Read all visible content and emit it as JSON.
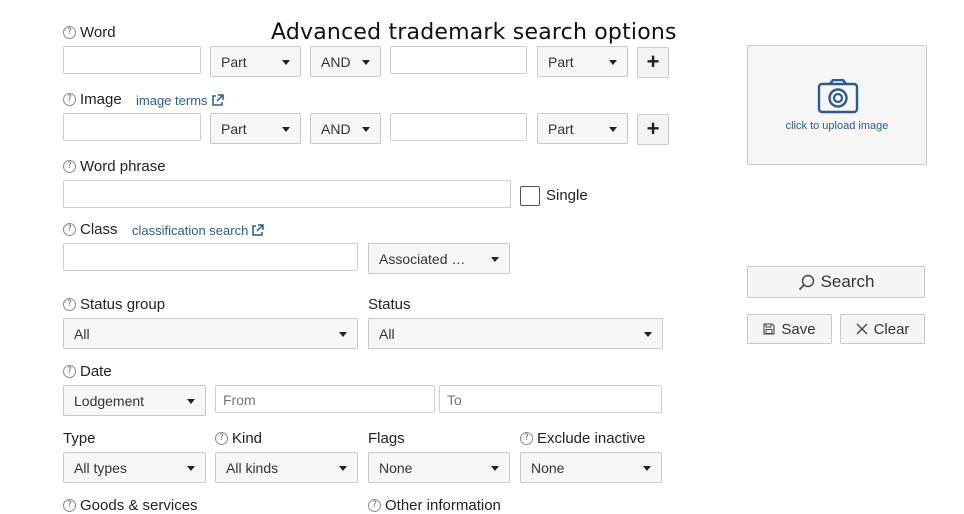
{
  "page": {
    "title": "Advanced trademark search options"
  },
  "word": {
    "label": "Word",
    "value": "",
    "match1": "Part",
    "operator": "AND",
    "value2": "",
    "match2": "Part",
    "add_label": "+"
  },
  "image": {
    "label": "Image",
    "terms_link": "image terms",
    "value": "",
    "match1": "Part",
    "operator": "AND",
    "value2": "",
    "match2": "Part",
    "add_label": "+"
  },
  "word_phrase": {
    "label": "Word phrase",
    "value": "",
    "single_label": "Single",
    "single_checked": false
  },
  "class": {
    "label": "Class",
    "classification_link": "classification search",
    "value": "",
    "mode": "Associated …"
  },
  "status_group": {
    "label": "Status group",
    "value": "All"
  },
  "status": {
    "label": "Status",
    "value": "All"
  },
  "date": {
    "label": "Date",
    "type": "Lodgement",
    "from_placeholder": "From",
    "to_placeholder": "To"
  },
  "type": {
    "label": "Type",
    "value": "All types"
  },
  "kind": {
    "label": "Kind",
    "value": "All kinds"
  },
  "flags": {
    "label": "Flags",
    "value": "None"
  },
  "exclude_inactive": {
    "label": "Exclude inactive",
    "value": "None"
  },
  "goods_services": {
    "label": "Goods & services"
  },
  "other_information": {
    "label": "Other information"
  },
  "upload": {
    "text": "click to upload image",
    "icon": "camera-icon",
    "icon_color": "#2a5d8f"
  },
  "actions": {
    "search_label": "Search",
    "save_label": "Save",
    "clear_label": "Clear"
  },
  "help_symbol": "?"
}
